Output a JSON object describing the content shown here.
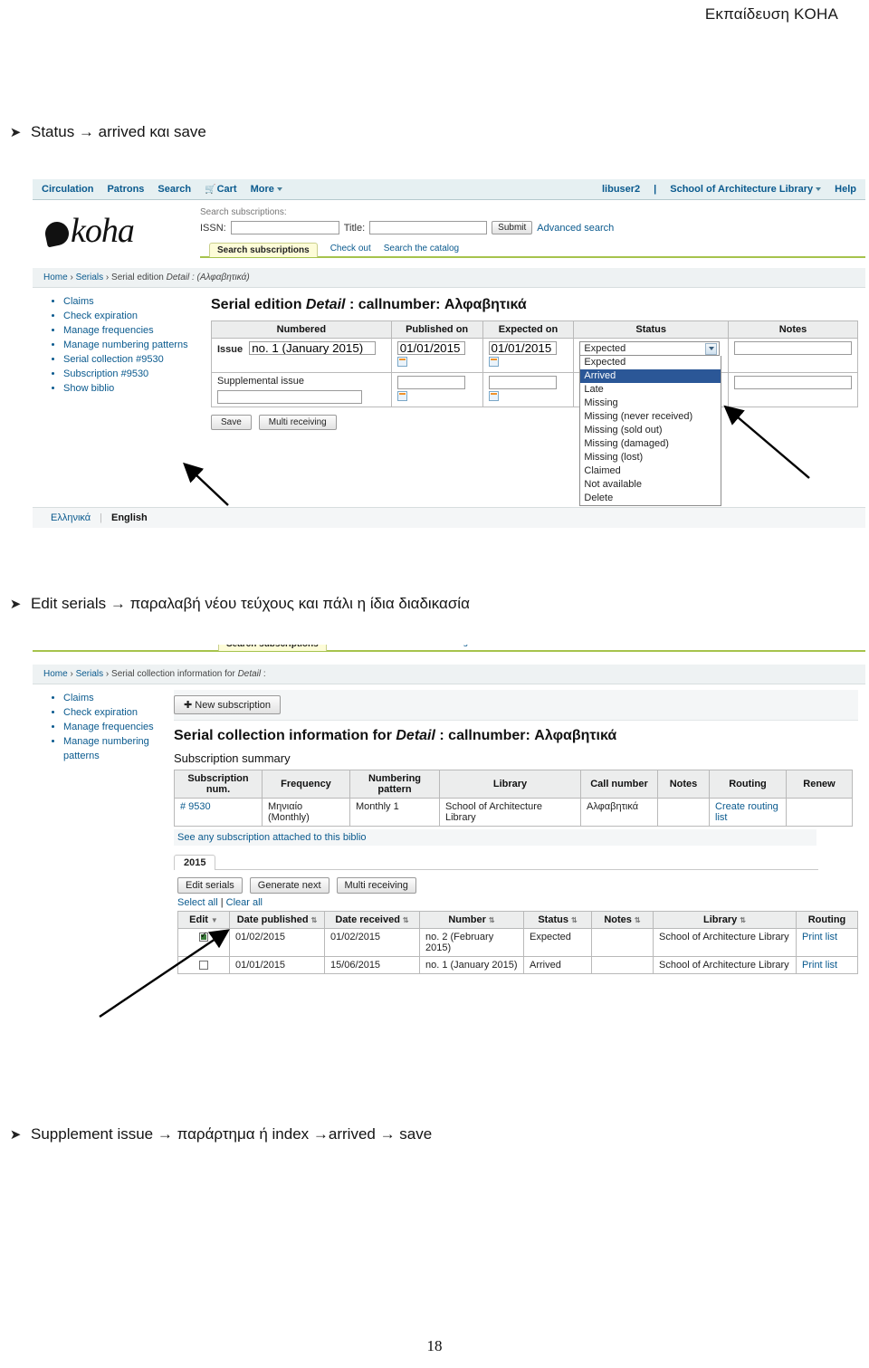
{
  "document": {
    "header_title": "Εκπαίδευση KOHA",
    "page_number": "18"
  },
  "bullets": [
    {
      "marker": "➤",
      "text": "Status → arrived και save"
    },
    {
      "marker": "➤",
      "text": "Edit serials → παραλαβή νέου τεύχους και πάλι η ίδια διαδικασία"
    },
    {
      "marker": "➤",
      "text": "Supplement issue → παράρτημα ή  index →arrived → save"
    }
  ],
  "screenshot1": {
    "navbar": {
      "left_items": [
        "Circulation",
        "Patrons",
        "Search",
        "Cart",
        "More"
      ],
      "cart_icon": "cart-icon",
      "more_caret": "chevron-down-icon",
      "user": "libuser2",
      "separator": "|",
      "library": "School of Architecture Library",
      "library_caret": "chevron-down-icon",
      "help": "Help"
    },
    "logo": {
      "text": "koha",
      "mark": "koha-logo-mark"
    },
    "search": {
      "label": "Search subscriptions:",
      "issn_label": "ISSN:",
      "issn_value": "",
      "title_label": "Title:",
      "title_value": "",
      "submit_label": "Submit",
      "advanced_label": "Advanced search"
    },
    "tabs": [
      {
        "label": "Search subscriptions",
        "active": true
      },
      {
        "label": "Check out",
        "active": false
      },
      {
        "label": "Search the catalog",
        "active": false
      }
    ],
    "breadcrumb": {
      "home": "Home",
      "serials": "Serials",
      "current_prefix": "Serial edition ",
      "current_italic": "Detail",
      "current_suffix": " : (Αλφαβητικά)"
    },
    "sidebar": [
      "Claims",
      "Check expiration",
      "Manage frequencies",
      "Manage numbering patterns",
      "Serial collection #9530",
      "Subscription #9530",
      "Show biblio"
    ],
    "page_title": {
      "prefix": "Serial edition ",
      "italic": "Detail",
      "suffix": " : callnumber: Αλφαβητικά"
    },
    "table": {
      "headers": [
        "Numbered",
        "Published on",
        "Expected on",
        "Status",
        "Notes"
      ],
      "row_issue": {
        "label": "Issue",
        "numbered_value": "no. 1 (January 2015)",
        "published_value": "01/01/2015",
        "expected_value": "01/01/2015",
        "status_value": "Expected",
        "notes_value": ""
      },
      "row_supplemental": {
        "label": "Supplemental issue",
        "numbered_value": "",
        "published_value": "",
        "expected_value": "",
        "notes_value": ""
      },
      "calendar_icon": "calendar-icon"
    },
    "status_dropdown": {
      "selected_display": "Expected",
      "highlighted": "Arrived",
      "options": [
        "Expected",
        "Arrived",
        "Late",
        "Missing",
        "Missing (never received)",
        "Missing (sold out)",
        "Missing (damaged)",
        "Missing (lost)",
        "Claimed",
        "Not available",
        "Delete"
      ]
    },
    "buttons": {
      "save": "Save",
      "multi_receiving": "Multi receiving"
    },
    "language_bar": {
      "greek": "Ελληνικά",
      "english": "English"
    },
    "annotations": [
      {
        "name": "arrow-to-save-button",
        "target": "Save"
      },
      {
        "name": "arrow-to-notes-field",
        "target": "Notes"
      }
    ]
  },
  "screenshot2": {
    "breadcrumb": {
      "home": "Home",
      "serials": "Serials",
      "current_prefix": "Serial collection information for ",
      "current_italic": "Detail",
      "current_suffix": " :"
    },
    "sidebar": [
      "Claims",
      "Check expiration",
      "Manage frequencies",
      "Manage numbering patterns"
    ],
    "toolbar": {
      "new_subscription": "New subscription",
      "plus_icon": "plus-icon"
    },
    "page_title": {
      "prefix": "Serial collection information for ",
      "italic": "Detail",
      "suffix": " : callnumber: Αλφαβητικά"
    },
    "summary_heading": "Subscription summary",
    "summary_table": {
      "headers": [
        "Subscription num.",
        "Frequency",
        "Numbering pattern",
        "Library",
        "Call number",
        "Notes",
        "Routing",
        "Renew"
      ],
      "row": {
        "subscription_num": "# 9530",
        "frequency": "Μηνιαίο (Monthly)",
        "numbering_pattern": "Monthly 1",
        "library": "School of Architecture Library",
        "call_number": "Αλφαβητικά",
        "notes": "",
        "routing": "Create routing list",
        "renew": ""
      },
      "footer_link": "See any subscription attached to this biblio"
    },
    "year_tab": "2015",
    "buttons": {
      "edit_serials": "Edit serials",
      "generate_next": "Generate next",
      "multi_receiving": "Multi receiving"
    },
    "select_links": {
      "select_all": "Select all",
      "divider": "|",
      "clear_all": "Clear all"
    },
    "serials_table": {
      "headers": [
        "Edit",
        "Date published",
        "Date received",
        "Number",
        "Status",
        "Notes",
        "Library",
        "Routing"
      ],
      "rows": [
        {
          "checked": true,
          "date_published": "01/02/2015",
          "date_received": "01/02/2015",
          "number": "no. 2 (February 2015)",
          "status": "Expected",
          "notes": "",
          "library": "School of Architecture Library",
          "routing": "Print list"
        },
        {
          "checked": false,
          "date_published": "01/01/2015",
          "date_received": "15/06/2015",
          "number": "no. 1 (January 2015)",
          "status": "Arrived",
          "notes": "",
          "library": "School of Architecture Library",
          "routing": "Print list"
        }
      ]
    },
    "annotations": [
      {
        "name": "arrow-to-edit-serials-button",
        "target": "Edit serials"
      }
    ]
  },
  "colors": {
    "nav_bg": "#e6f0f2",
    "link_blue": "#0a5a8e",
    "tab_underline": "#a6c34c",
    "select_highlight": "#2b5797",
    "table_header_bg": "#eceded"
  }
}
